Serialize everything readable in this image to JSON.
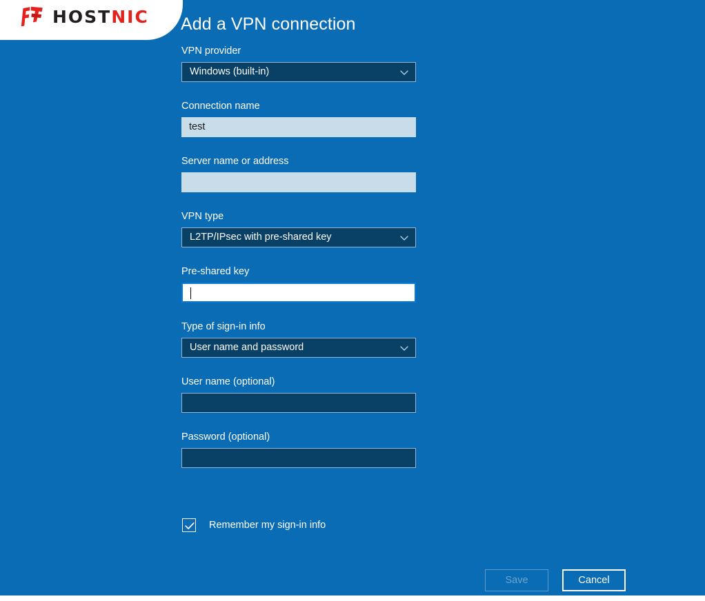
{
  "brand": {
    "logo_icon": "hostnic-flag-icon",
    "name_part_dark": "HOST",
    "name_part_red": "NIC",
    "color_red": "#e3221d",
    "color_dark": "#231f20"
  },
  "theme": {
    "background_blue": "#0a6cb4",
    "field_dark_navy": "#084066",
    "field_light": "#c9dcea",
    "field_border": "#94b6d2",
    "focus_border": "#0a7ad4",
    "text_white": "#ffffff",
    "disabled_text": "#6fa4cd"
  },
  "header": {
    "title": "Add a VPN connection"
  },
  "form": {
    "vpn_provider": {
      "label": "VPN provider",
      "value": "Windows (built-in)",
      "icon": "chevron-down-icon"
    },
    "connection_name": {
      "label": "Connection name",
      "value": "test",
      "placeholder": ""
    },
    "server_name": {
      "label": "Server name or address",
      "value": "",
      "placeholder": ""
    },
    "vpn_type": {
      "label": "VPN type",
      "value": "L2TP/IPsec with pre-shared key",
      "icon": "chevron-down-icon"
    },
    "pre_shared_key": {
      "label": "Pre-shared key",
      "value": "",
      "placeholder": ""
    },
    "sign_in_type": {
      "label": "Type of sign-in info",
      "value": "User name and password",
      "icon": "chevron-down-icon"
    },
    "user_name": {
      "label": "User name (optional)",
      "value": "",
      "placeholder": ""
    },
    "password": {
      "label": "Password (optional)",
      "value": "",
      "placeholder": ""
    },
    "remember": {
      "label": "Remember my sign-in info",
      "checked": true
    }
  },
  "footer": {
    "save_label": "Save",
    "save_disabled": true,
    "cancel_label": "Cancel"
  }
}
